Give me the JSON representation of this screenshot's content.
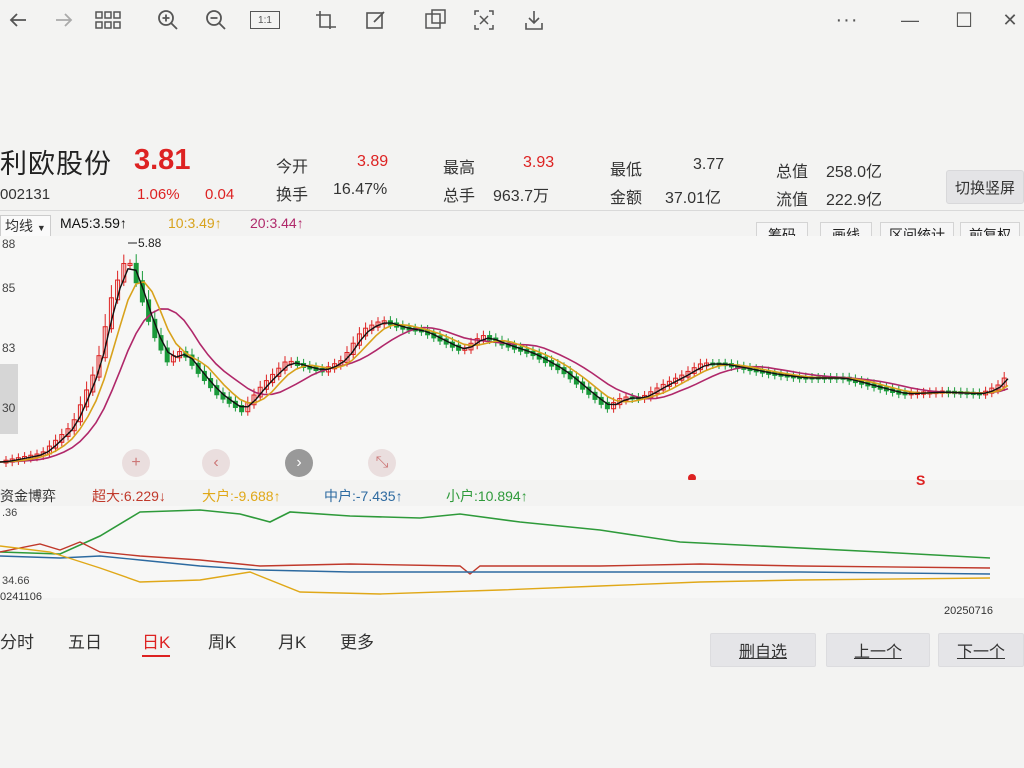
{
  "toolbar": {
    "icons": [
      "back-arrow-icon",
      "forward-arrow-icon",
      "grid-icon",
      "zoom-in-icon",
      "zoom-out-icon",
      "actual-size-icon",
      "crop-icon",
      "edit-icon",
      "screenshot-icon",
      "ocr-icon",
      "download-icon",
      "more-icon"
    ],
    "actual_size_label": "1:1",
    "more_label": "···",
    "minimize": "—",
    "maximize": "☐",
    "close": "✕"
  },
  "quote": {
    "name": "利欧股份",
    "price": "3.81",
    "code": "002131",
    "change_pct": "1.06%",
    "change": "0.04",
    "open_label": "今开",
    "open": "3.89",
    "turnover_label": "换手",
    "turnover": "16.47%",
    "high_label": "最高",
    "high": "3.93",
    "volume_label": "总手",
    "volume": "963.7万",
    "low_label": "最低",
    "low": "3.77",
    "amount_label": "金额",
    "amount": "37.01亿",
    "total_mv_label": "总值",
    "total_mv": "258.0亿",
    "float_mv_label": "流值",
    "float_mv": "222.9亿",
    "switch_label": "切换竖屏"
  },
  "kline": {
    "indicator_select": "均线",
    "ma5": "MA5:3.59↑",
    "ma10": "10:3.49↑",
    "ma20": "20:3.44↑",
    "buttons": [
      "筹码",
      "画线",
      "区间统计",
      "前复权"
    ],
    "yaxis": [
      "88",
      "85",
      "83",
      "30"
    ],
    "max_label": "5.88",
    "nav": {
      "plus": "+",
      "left": "‹",
      "right": "›",
      "fullscreen": "⤡"
    },
    "marker_s": "S",
    "colors": {
      "up": "#d22",
      "down": "#1a9a3a",
      "ma5": "#111",
      "ma10": "#d8a21c",
      "ma20": "#b0286a"
    }
  },
  "fund_flow": {
    "title": "资金博弈",
    "super": "超大:6.229↓",
    "large": "大户:-9.688↑",
    "mid": "中户:-7.435↑",
    "small": "小户:10.894↑",
    "y_top": ".36",
    "y_bottom": "34.66",
    "date_start": "0241106",
    "date_end": "20250716",
    "colors": {
      "super": "#c0392b",
      "large": "#e0a818",
      "mid": "#2d6aa0",
      "small": "#2e9a3a"
    }
  },
  "periods": [
    "分时",
    "五日",
    "日K",
    "周K",
    "月K",
    "更多"
  ],
  "active_period": "日K",
  "actions": {
    "remove": "删自选",
    "prev": "上一个",
    "next": "下一个"
  }
}
